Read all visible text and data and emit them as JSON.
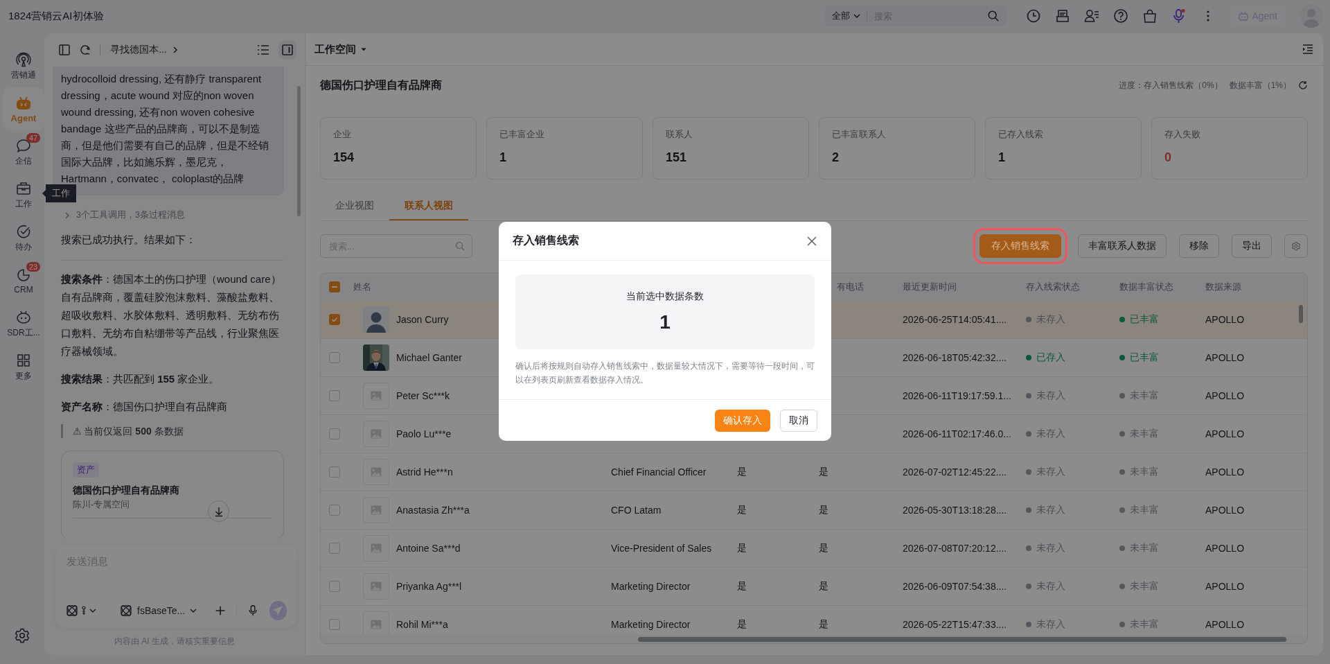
{
  "app_title": "1824营销云AI初体验",
  "top_search": {
    "scope": "全部",
    "placeholder": "搜索"
  },
  "agent_button": "Agent",
  "rail": [
    {
      "kind": "broadcast",
      "label": "营销通",
      "selected": false
    },
    {
      "kind": "robot",
      "label": "Agent",
      "selected": true
    },
    {
      "kind": "chat",
      "label": "企信",
      "selected": false,
      "badge": "47"
    },
    {
      "kind": "briefcase",
      "label": "工作",
      "selected": false
    },
    {
      "kind": "check",
      "label": "待办",
      "selected": false
    },
    {
      "kind": "pie",
      "label": "CRM",
      "selected": false,
      "badge": "23"
    },
    {
      "kind": "bot",
      "label": "SDR工...",
      "selected": false
    },
    {
      "kind": "grid",
      "label": "更多",
      "selected": false
    }
  ],
  "tooltip": "工作",
  "chat": {
    "title": "寻找德国本...",
    "blocks": [
      {
        "kind": "bubble",
        "text": "hydrocolloid dressing, 还有静疗 transparent dressing，acute wound 对应的non woven wound dressing, 还有non woven cohesive bandage 这些产品的品牌商，可以不是制造商，但是他们需要有自己的品牌，但是不经销国际大品牌，比如施乐辉，墨尼克，Hartmann，convatec， coloplast的品牌"
      },
      {
        "kind": "tools",
        "text": "3个工具调用，3条过程消息"
      },
      {
        "kind": "text",
        "text": "搜索已成功执行。结果如下："
      },
      {
        "kind": "rule"
      },
      {
        "kind": "text",
        "text": "**搜索条件**：德国本土的伤口护理（wound care）自有品牌商，覆盖硅胶泡沫敷料、藻酸盐敷料、超吸收敷料、水胶体敷料、透明敷料、无纺布伤口敷料、无纺布自粘绷带等产品线，行业聚焦医疗器械领域。"
      },
      {
        "kind": "text",
        "text": "**搜索结果**：共匹配到 **155** 家企业。"
      },
      {
        "kind": "text",
        "text": "**资产名称**：德国伤口护理自有品牌商"
      },
      {
        "kind": "quote",
        "text": "⚠ 当前仅返回 **500** 条数据"
      },
      {
        "kind": "card",
        "tag": "资产",
        "title": "德国伤口护理自有品牌商",
        "subtitle": "陈川-专属空间"
      }
    ],
    "input_placeholder": "发送消息",
    "model": "fsBaseTe...",
    "footer": "内容由 AI 生成，请核实重要信息"
  },
  "workspace": "工作空间",
  "asset": {
    "title": "德国伤口护理自有品牌商",
    "progress": [
      "进度：存入销售线索（0%）",
      "数据丰富（1%）"
    ]
  },
  "stats": [
    {
      "label": "企业",
      "value": "154",
      "alert": false
    },
    {
      "label": "已丰富企业",
      "value": "1",
      "alert": false
    },
    {
      "label": "联系人",
      "value": "151",
      "alert": false
    },
    {
      "label": "已丰富联系人",
      "value": "2",
      "alert": false
    },
    {
      "label": "已存入线索",
      "value": "1",
      "alert": false
    },
    {
      "label": "存入失败",
      "value": "0",
      "alert": true
    }
  ],
  "tabs": [
    {
      "label": "企业视图",
      "selected": false
    },
    {
      "label": "联系人视图",
      "selected": true
    }
  ],
  "toolbar": {
    "search_placeholder": "搜索...",
    "buttons": [
      {
        "label": "存入销售线索",
        "primary": true,
        "highlighted": true
      },
      {
        "label": "丰富联系人数据",
        "primary": false,
        "highlighted": false
      },
      {
        "label": "移除",
        "primary": false,
        "highlighted": false
      },
      {
        "label": "导出",
        "primary": false,
        "highlighted": false
      }
    ]
  },
  "table": {
    "select_all": {
      "indeterminate": true
    },
    "headers": {
      "name": "姓名",
      "column_4": "有电话",
      "updated": "最近更新时间",
      "lead_status": "存入线索状态",
      "enrich_status": "数据丰富状态",
      "source": "数据来源"
    },
    "rows": [
      {
        "checked": true,
        "selected": true,
        "avatar": {
          "kind": "silhouette"
        },
        "name": "Jason Curry",
        "updated": "2026-06-25T14:05:41....",
        "lead_status": "未存入",
        "saved": false,
        "enrich_status": "已丰富",
        "enriched": true,
        "source": "APOLLO"
      },
      {
        "checked": false,
        "selected": false,
        "name": "Michael Ganter",
        "updated": "2026-06-18T05:42:32....",
        "lead_status": "已存入",
        "saved": true,
        "enrich_status": "已丰富",
        "enriched": true,
        "source": "APOLLO"
      },
      {
        "checked": false,
        "selected": false,
        "avatar": {
          "kind": "placeholder"
        },
        "name": "Peter Sc***k",
        "updated": "2026-06-11T19:17:59.1...",
        "lead_status": "未存入",
        "saved": false,
        "enrich_status": "未丰富",
        "enriched": false,
        "source": "APOLLO"
      },
      {
        "checked": false,
        "selected": false,
        "avatar": {
          "kind": "placeholder"
        },
        "name": "Paolo Lu***e",
        "updated": "2026-06-11T02:17:46.0...",
        "lead_status": "未存入",
        "saved": false,
        "enrich_status": "未丰富",
        "enriched": false,
        "source": "APOLLO"
      },
      {
        "checked": false,
        "selected": false,
        "avatar": {
          "kind": "placeholder"
        },
        "name": "Astrid He***n",
        "column_2": "Chief Financial Officer",
        "column_3": "是",
        "column_4": "是",
        "updated": "2026-07-02T12:45:22....",
        "lead_status": "未存入",
        "saved": false,
        "enrich_status": "未丰富",
        "enriched": false,
        "source": "APOLLO"
      },
      {
        "checked": false,
        "selected": false,
        "avatar": {
          "kind": "placeholder"
        },
        "name": "Anastasia Zh***a",
        "column_2": "CFO Latam",
        "column_3": "是",
        "column_4": "是",
        "updated": "2026-05-30T13:18:28....",
        "lead_status": "未存入",
        "saved": false,
        "enrich_status": "未丰富",
        "enriched": false,
        "source": "APOLLO"
      },
      {
        "checked": false,
        "selected": false,
        "avatar": {
          "kind": "placeholder"
        },
        "name": "Antoine Sa***d",
        "column_2": "Vice-President of Sales",
        "column_3": "是",
        "column_4": "是",
        "updated": "2026-07-08T07:20:12....",
        "lead_status": "未存入",
        "saved": false,
        "enrich_status": "未丰富",
        "enriched": false,
        "source": "APOLLO"
      },
      {
        "checked": false,
        "selected": false,
        "avatar": {
          "kind": "placeholder"
        },
        "name": "Priyanka Ag***l",
        "column_2": "Marketing Director",
        "column_3": "是",
        "column_4": "是",
        "updated": "2026-06-09T07:54:38....",
        "lead_status": "未存入",
        "saved": false,
        "enrich_status": "未丰富",
        "enriched": false,
        "source": "APOLLO"
      },
      {
        "checked": false,
        "selected": false,
        "avatar": {
          "kind": "placeholder"
        },
        "name": "Rohil Mi***a",
        "column_2": "Marketing Director",
        "column_3": "是",
        "column_4": "是",
        "updated": "2026-05-22T15:47:33....",
        "lead_status": "未存入",
        "saved": false,
        "enrich_status": "未丰富",
        "enriched": false,
        "source": "APOLLO"
      }
    ]
  },
  "modal": {
    "title": "存入销售线索",
    "count_label": "当前选中数据条数",
    "count": "1",
    "note": "确认后将按规则自动存入销售线索中，数据量较大情况下，需要等待一段时间，可以在列表页刷新查看数据存入情况。",
    "confirm": "确认存入",
    "cancel": "取消"
  }
}
